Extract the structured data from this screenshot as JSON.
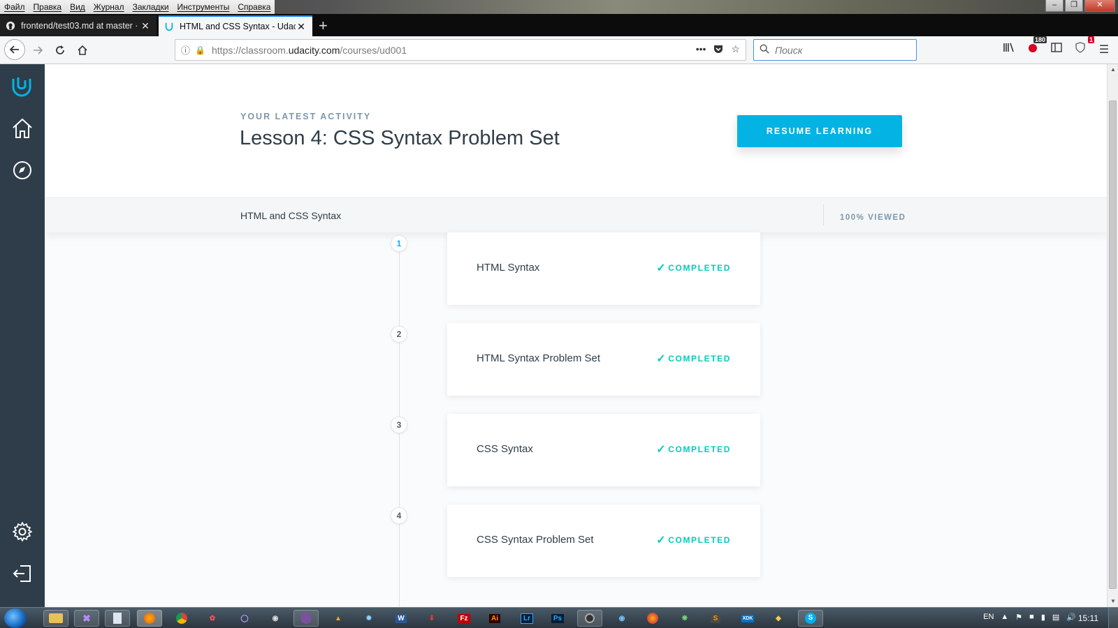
{
  "browser": {
    "menu": [
      "Файл",
      "Правка",
      "Вид",
      "Журнал",
      "Закладки",
      "Инструменты",
      "Справка"
    ],
    "tabs": [
      {
        "title": "frontend/test03.md at master ·",
        "icon": "github-icon",
        "active": false
      },
      {
        "title": "HTML and CSS Syntax - Udacity",
        "icon": "udacity-icon",
        "active": true
      }
    ],
    "url": {
      "prefix": "https://classroom.",
      "domain": "udacity.com",
      "path": "/courses/ud001"
    },
    "search_placeholder": "Поиск",
    "badges": {
      "adblock": "180",
      "notifications": "1"
    }
  },
  "activity": {
    "kicker": "YOUR LATEST ACTIVITY",
    "title": "Lesson 4: CSS Syntax Problem Set",
    "resume_label": "RESUME LEARNING"
  },
  "course": {
    "title": "HTML and CSS Syntax",
    "progress": "100% VIEWED"
  },
  "lessons": [
    {
      "number": "1",
      "title": "HTML Syntax",
      "status": "COMPLETED"
    },
    {
      "number": "2",
      "title": "HTML Syntax Problem Set",
      "status": "COMPLETED"
    },
    {
      "number": "3",
      "title": "CSS Syntax",
      "status": "COMPLETED"
    },
    {
      "number": "4",
      "title": "CSS Syntax Problem Set",
      "status": "COMPLETED"
    }
  ],
  "taskbar": {
    "lang": "EN",
    "clock": "15:11"
  },
  "colors": {
    "accent": "#02b3e4",
    "completed": "#02ccba",
    "sidebar": "#2e3d49"
  }
}
